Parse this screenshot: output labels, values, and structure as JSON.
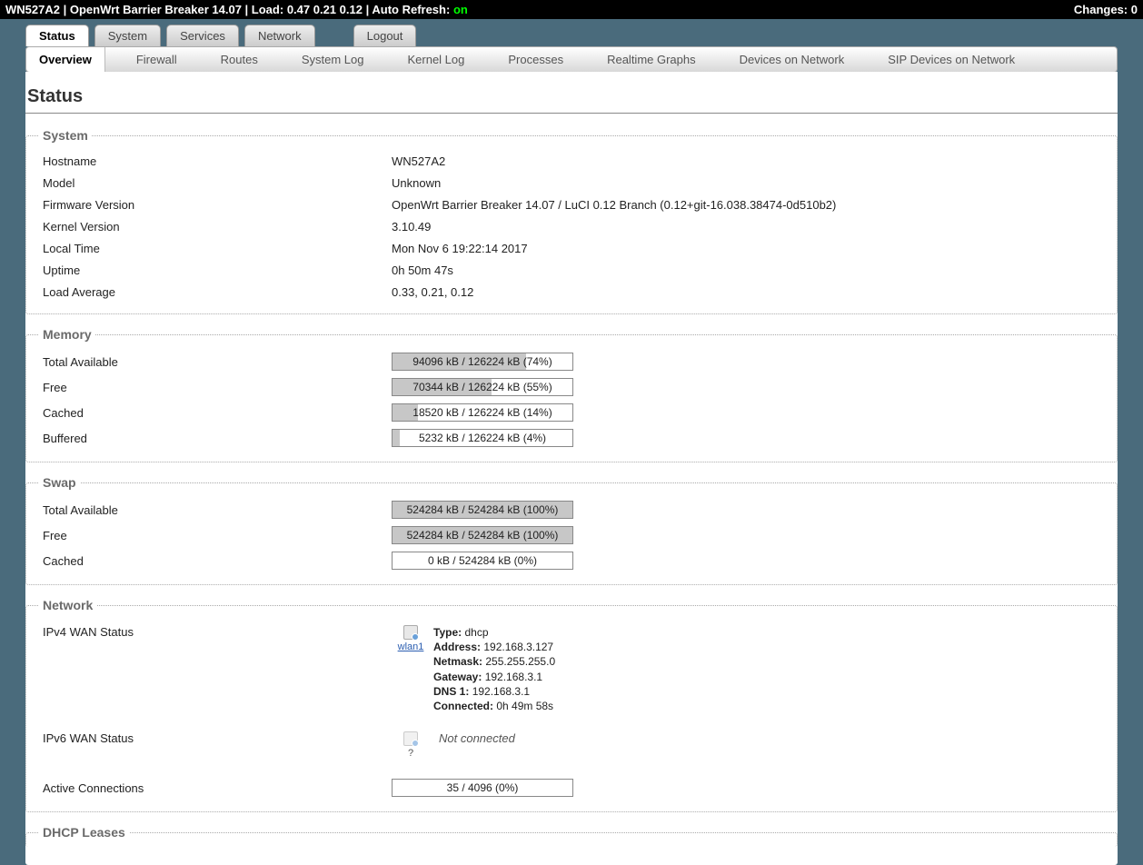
{
  "topbar": {
    "host": "WN527A2",
    "firmware_short": "OpenWrt Barrier Breaker 14.07",
    "load_label": "Load:",
    "load": "0.47 0.21 0.12",
    "refresh_label": "Auto Refresh:",
    "refresh_state": "on",
    "changes_label": "Changes:",
    "changes_count": "0"
  },
  "tabs": {
    "status": "Status",
    "system": "System",
    "services": "Services",
    "network": "Network",
    "logout": "Logout"
  },
  "subtabs": {
    "overview": "Overview",
    "firewall": "Firewall",
    "routes": "Routes",
    "system_log": "System Log",
    "kernel_log": "Kernel Log",
    "processes": "Processes",
    "realtime_graphs": "Realtime Graphs",
    "devices_on_network": "Devices on Network",
    "sip_devices": "SIP Devices on Network"
  },
  "page_title": "Status",
  "system": {
    "legend": "System",
    "hostname_label": "Hostname",
    "hostname": "WN527A2",
    "model_label": "Model",
    "model": "Unknown",
    "fw_label": "Firmware Version",
    "fw": "OpenWrt Barrier Breaker 14.07 / LuCI 0.12 Branch (0.12+git-16.038.38474-0d510b2)",
    "kernel_label": "Kernel Version",
    "kernel": "3.10.49",
    "localtime_label": "Local Time",
    "localtime": "Mon Nov 6 19:22:14 2017",
    "uptime_label": "Uptime",
    "uptime": "0h 50m 47s",
    "loadavg_label": "Load Average",
    "loadavg": "0.33, 0.21, 0.12"
  },
  "memory": {
    "legend": "Memory",
    "total_label": "Total Available",
    "total_text": "94096 kB / 126224 kB (74%)",
    "total_pct": "74",
    "free_label": "Free",
    "free_text": "70344 kB / 126224 kB (55%)",
    "free_pct": "55",
    "cached_label": "Cached",
    "cached_text": "18520 kB / 126224 kB (14%)",
    "cached_pct": "14",
    "buffered_label": "Buffered",
    "buffered_text": "5232 kB / 126224 kB (4%)",
    "buffered_pct": "4"
  },
  "swap": {
    "legend": "Swap",
    "total_label": "Total Available",
    "total_text": "524284 kB / 524284 kB (100%)",
    "total_pct": "100",
    "free_label": "Free",
    "free_text": "524284 kB / 524284 kB (100%)",
    "free_pct": "100",
    "cached_label": "Cached",
    "cached_text": "0 kB / 524284 kB (0%)",
    "cached_pct": "0"
  },
  "network": {
    "legend": "Network",
    "ipv4_label": "IPv4 WAN Status",
    "ipv4": {
      "iface": "wlan1",
      "type_label": "Type:",
      "type": "dhcp",
      "address_label": "Address:",
      "address": "192.168.3.127",
      "netmask_label": "Netmask:",
      "netmask": "255.255.255.0",
      "gateway_label": "Gateway:",
      "gateway": "192.168.3.1",
      "dns1_label": "DNS 1:",
      "dns1": "192.168.3.1",
      "connected_label": "Connected:",
      "connected": "0h 49m 58s"
    },
    "ipv6_label": "IPv6 WAN Status",
    "ipv6_q": "?",
    "ipv6_not_connected": "Not connected",
    "active_conn_label": "Active Connections",
    "active_conn_text": "35 / 4096 (0%)",
    "active_conn_pct": "0"
  },
  "dhcp": {
    "legend": "DHCP Leases"
  }
}
